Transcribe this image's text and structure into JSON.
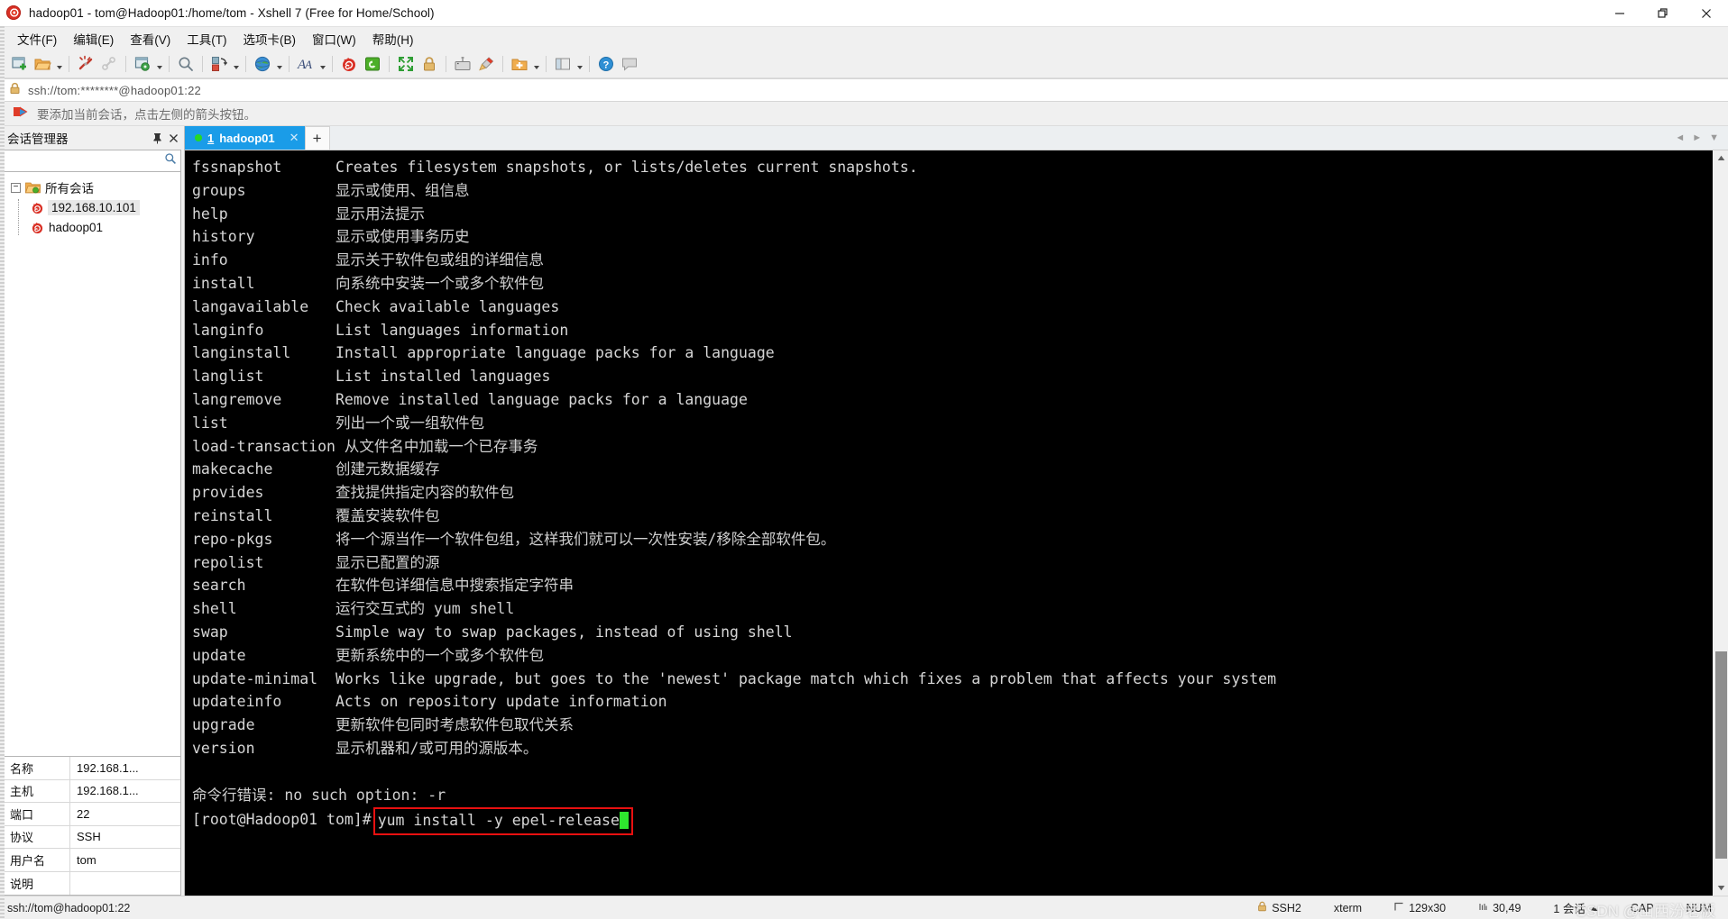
{
  "window": {
    "title": "hadoop01 - tom@Hadoop01:/home/tom - Xshell 7 (Free for Home/School)",
    "app_icon": "snail-icon",
    "minimize_label": "—",
    "restore_label": "❐",
    "close_label": "✕"
  },
  "menubar": {
    "items": [
      {
        "label": "文件(F)",
        "name": "menu-file"
      },
      {
        "label": "编辑(E)",
        "name": "menu-edit"
      },
      {
        "label": "查看(V)",
        "name": "menu-view"
      },
      {
        "label": "工具(T)",
        "name": "menu-tools"
      },
      {
        "label": "选项卡(B)",
        "name": "menu-tabs"
      },
      {
        "label": "窗口(W)",
        "name": "menu-window"
      },
      {
        "label": "帮助(H)",
        "name": "menu-help"
      }
    ]
  },
  "toolbar": {
    "buttons": [
      "new-session-icon",
      "open-folder-icon",
      "disconnect-icon",
      "link-icon",
      "properties-icon",
      "find-icon",
      "transfer-icon",
      "globe-icon",
      "font-icon",
      "snail-icon",
      "green-app-icon",
      "fullscreen-icon",
      "lock-icon",
      "keyboard-icon",
      "highlighter-icon",
      "add-folder-icon",
      "layout-icon",
      "help-icon",
      "chat-icon"
    ]
  },
  "address": {
    "lock_icon": "lock-icon",
    "url": "ssh://tom:********@hadoop01:22"
  },
  "notice": {
    "icon": "red-blue-arrow-icon",
    "text": "要添加当前会话，点击左侧的箭头按钮。"
  },
  "sidebar": {
    "title": "会话管理器",
    "pin_label": "⚐",
    "close_label": "✕",
    "search_placeholder": "",
    "search_value": "",
    "search_icon": "search-icon",
    "tree": {
      "root": {
        "label": "所有会话",
        "icon": "folder-icon",
        "expander": "−"
      },
      "children": [
        {
          "label": "192.168.10.101",
          "icon": "session-icon",
          "selected": true
        },
        {
          "label": "hadoop01",
          "icon": "session-icon",
          "selected": false
        }
      ]
    },
    "properties": [
      {
        "key": "名称",
        "value": "192.168.1..."
      },
      {
        "key": "主机",
        "value": "192.168.1..."
      },
      {
        "key": "端口",
        "value": "22"
      },
      {
        "key": "协议",
        "value": "SSH"
      },
      {
        "key": "用户名",
        "value": "tom"
      },
      {
        "key": "说明",
        "value": ""
      }
    ]
  },
  "tabs": {
    "items": [
      {
        "number": "1",
        "name": "hadoop01",
        "status": "connected",
        "close_label": "✕"
      }
    ],
    "add_label": "+",
    "nav_prev": "◄",
    "nav_next": "►",
    "nav_menu": "▼"
  },
  "terminal": {
    "lines": [
      {
        "cmd": "fssnapshot",
        "desc": "Creates filesystem snapshots, or lists/deletes current snapshots.",
        "cjk": false
      },
      {
        "cmd": "groups",
        "desc": "显示或使用、组信息",
        "cjk": true
      },
      {
        "cmd": "help",
        "desc": "显示用法提示",
        "cjk": true
      },
      {
        "cmd": "history",
        "desc": "显示或使用事务历史",
        "cjk": true
      },
      {
        "cmd": "info",
        "desc": "显示关于软件包或组的详细信息",
        "cjk": true
      },
      {
        "cmd": "install",
        "desc": "向系统中安装一个或多个软件包",
        "cjk": true
      },
      {
        "cmd": "langavailable",
        "desc": "Check available languages",
        "cjk": false
      },
      {
        "cmd": "langinfo",
        "desc": "List languages information",
        "cjk": false
      },
      {
        "cmd": "langinstall",
        "desc": "Install appropriate language packs for a language",
        "cjk": false
      },
      {
        "cmd": "langlist",
        "desc": "List installed languages",
        "cjk": false
      },
      {
        "cmd": "langremove",
        "desc": "Remove installed language packs for a language",
        "cjk": false
      },
      {
        "cmd": "list",
        "desc": "列出一个或一组软件包",
        "cjk": true
      },
      {
        "cmd": "load-transaction",
        "desc": "从文件名中加载一个已存事务",
        "cjk": true
      },
      {
        "cmd": "makecache",
        "desc": "创建元数据缓存",
        "cjk": true
      },
      {
        "cmd": "provides",
        "desc": "查找提供指定内容的软件包",
        "cjk": true
      },
      {
        "cmd": "reinstall",
        "desc": "覆盖安装软件包",
        "cjk": true
      },
      {
        "cmd": "repo-pkgs",
        "desc": "将一个源当作一个软件包组，这样我们就可以一次性安装/移除全部软件包。",
        "cjk": true
      },
      {
        "cmd": "repolist",
        "desc": "显示已配置的源",
        "cjk": true
      },
      {
        "cmd": "search",
        "desc": "在软件包详细信息中搜索指定字符串",
        "cjk": true
      },
      {
        "cmd": "shell",
        "desc": "运行交互式的 yum shell",
        "cjk": true
      },
      {
        "cmd": "swap",
        "desc": "Simple way to swap packages, instead of using shell",
        "cjk": false
      },
      {
        "cmd": "update",
        "desc": "更新系统中的一个或多个软件包",
        "cjk": true
      },
      {
        "cmd": "update-minimal",
        "desc": "Works like upgrade, but goes to the 'newest' package match which fixes a problem that affects your system",
        "cjk": false
      },
      {
        "cmd": "updateinfo",
        "desc": "Acts on repository update information",
        "cjk": false
      },
      {
        "cmd": "upgrade",
        "desc": "更新软件包同时考虑软件包取代关系",
        "cjk": true
      },
      {
        "cmd": "version",
        "desc": "显示机器和/或可用的源版本。",
        "cjk": true
      }
    ],
    "error_line": "命令行错误: no such option: -r",
    "prompt": "[root@Hadoop01 tom]#",
    "command": "yum install -y epel-release",
    "highlight_color": "#e81010",
    "cursor_color": "#2ee62e"
  },
  "statusbar": {
    "left": "ssh://tom@hadoop01:22",
    "security": "SSH2",
    "terminal_type": "xterm",
    "size": "129x30",
    "cursor_pos": "30,49",
    "sessions": "1 会话",
    "caps": "CAP",
    "num": "NUM",
    "watermark": "CSDN @山西汾老板"
  }
}
